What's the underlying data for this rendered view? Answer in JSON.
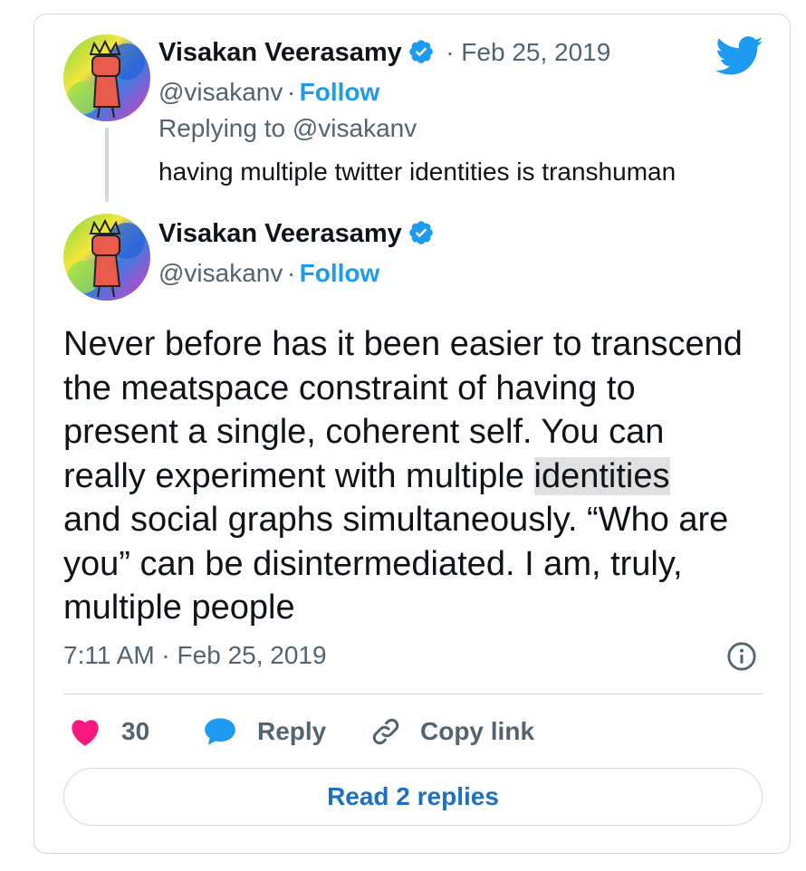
{
  "parent_tweet": {
    "author_name": "Visakan Veerasamy",
    "separator_date": "· Feb 25, 2019",
    "handle": "@visakanv",
    "dot": "·",
    "follow_label": "Follow",
    "replying_to": "Replying to @visakanv",
    "text": "having multiple twitter identities is transhuman"
  },
  "main_tweet": {
    "author_name": "Visakan Veerasamy",
    "handle": "@visakanv",
    "dot": "·",
    "follow_label": "Follow",
    "body_lines": [
      "Never before has it been easier to transcend",
      "the meatspace constraint of having to",
      "present a single, coherent self. You can",
      "really experiment with multiple ",
      "identities",
      "and social graphs simultaneously. “Who are",
      "you” can be disintermediated. I am, truly,",
      "multiple people"
    ],
    "timestamp": "7:11 AM · Feb 25, 2019"
  },
  "actions": {
    "like_count": "30",
    "reply_label": "Reply",
    "copy_link_label": "Copy link"
  },
  "read_replies_label": "Read 2 replies",
  "colors": {
    "twitter_blue": "#1d9bf0",
    "like_pink": "#f91880",
    "text_gray": "#536471",
    "border": "#cfd9de"
  },
  "icons": [
    "twitter-bird-icon",
    "verified-badge-icon",
    "info-icon",
    "heart-icon",
    "speech-bubble-icon",
    "link-icon"
  ]
}
